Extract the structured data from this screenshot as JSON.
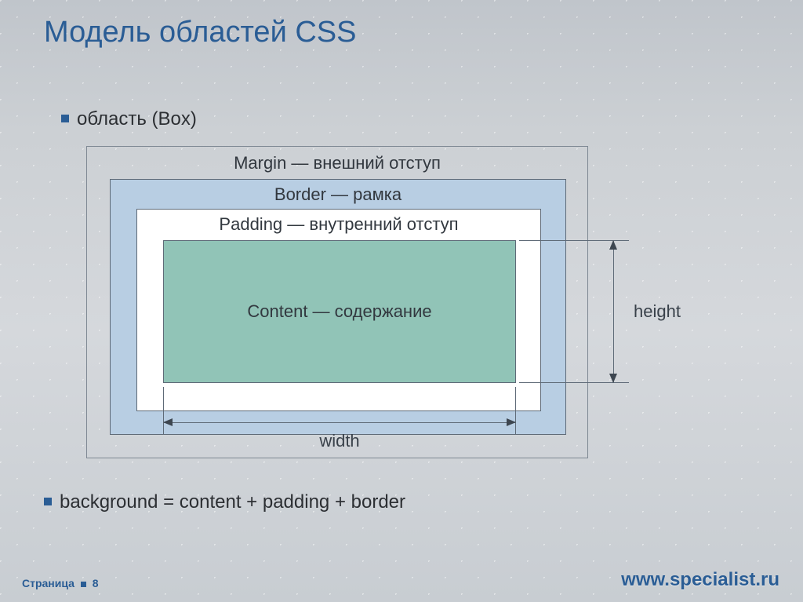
{
  "title": "Модель областей CSS",
  "bullets": {
    "box": "область (Box)",
    "background": "background = content + padding + border"
  },
  "boxmodel": {
    "margin": "Margin — внешний отступ",
    "border": "Border — рамка",
    "padding": "Padding — внутренний отступ",
    "content": "Content — содержание",
    "width": "width",
    "height": "height"
  },
  "footer": {
    "page_label": "Страница",
    "page_number": "8",
    "site": "www.specialist.ru"
  }
}
